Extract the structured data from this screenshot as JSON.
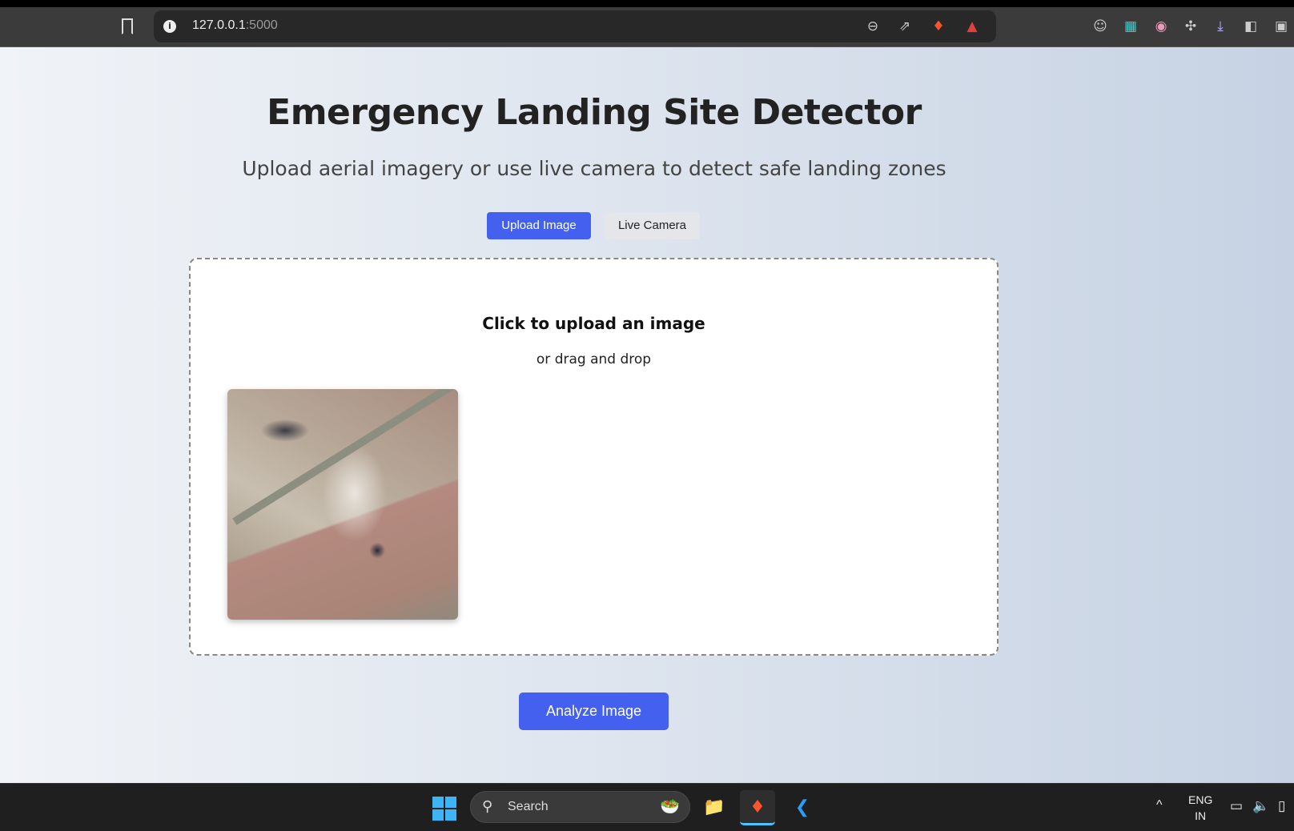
{
  "browser": {
    "url_host": "127.0.0.1",
    "url_port": ":5000"
  },
  "header": {
    "title": "Emergency Landing Site Detector",
    "subtitle": "Upload aerial imagery or use live camera to detect safe landing zones"
  },
  "modes": {
    "upload": "Upload Image",
    "camera": "Live Camera",
    "active": "upload"
  },
  "dropzone": {
    "title": "Click to upload an image",
    "hint": "or drag and drop"
  },
  "actions": {
    "analyze": "Analyze Image"
  },
  "taskbar": {
    "search": "Search",
    "lang": "ENG",
    "region": "IN"
  },
  "colors": {
    "accent": "#4361ee"
  }
}
